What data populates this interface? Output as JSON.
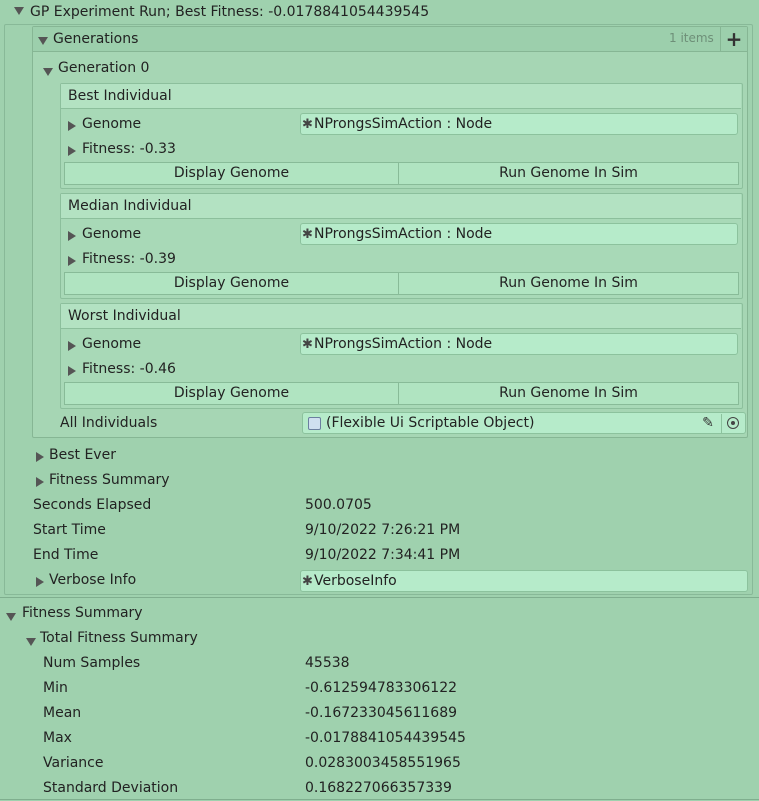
{
  "title": "GP Experiment Run; Best Fitness: -0.0178841054439545",
  "generations": {
    "label": "Generations",
    "count": "1 items",
    "add_icon": "plus-icon",
    "generation_label": "Generation 0",
    "individuals": [
      {
        "header": "Best Individual",
        "genome_label": "Genome",
        "genome_value": "NProngsSimAction : Node",
        "fitness": "Fitness: -0.33",
        "display_btn": "Display Genome",
        "run_btn": "Run Genome In Sim"
      },
      {
        "header": "Median Individual",
        "genome_label": "Genome",
        "genome_value": "NProngsSimAction : Node",
        "fitness": "Fitness: -0.39",
        "display_btn": "Display Genome",
        "run_btn": "Run Genome In Sim"
      },
      {
        "header": "Worst Individual",
        "genome_label": "Genome",
        "genome_value": "NProngsSimAction : Node",
        "fitness": "Fitness: -0.46",
        "display_btn": "Display Genome",
        "run_btn": "Run Genome In Sim"
      }
    ],
    "all_individuals_label": "All Individuals",
    "all_individuals_value": "(Flexible Ui Scriptable Object)"
  },
  "best_ever": "Best Ever",
  "fitness_summary_inner": "Fitness Summary",
  "props": [
    {
      "label": "Seconds Elapsed",
      "value": "500.0705"
    },
    {
      "label": "Start Time",
      "value": "9/10/2022 7:26:21 PM"
    },
    {
      "label": "End Time",
      "value": "9/10/2022 7:34:41 PM"
    }
  ],
  "verbose": {
    "label": "Verbose Info",
    "value": "VerboseInfo"
  },
  "fitness_summary": {
    "label": "Fitness Summary",
    "total_label": "Total Fitness Summary",
    "stats": [
      {
        "label": "Num Samples",
        "value": "45538"
      },
      {
        "label": "Min",
        "value": "-0.612594783306122"
      },
      {
        "label": "Mean",
        "value": "-0.167233045611689"
      },
      {
        "label": "Max",
        "value": "-0.0178841054439545"
      },
      {
        "label": "Variance",
        "value": "0.0283003458551965"
      },
      {
        "label": "Standard Deviation",
        "value": "0.168227066357339"
      }
    ]
  }
}
